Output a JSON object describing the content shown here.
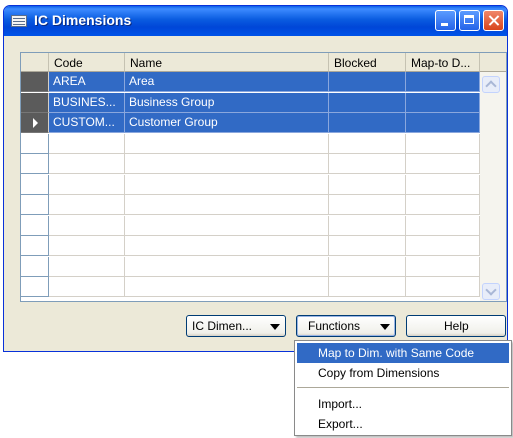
{
  "window": {
    "title": "IC Dimensions"
  },
  "grid": {
    "columns": [
      "Code",
      "Name",
      "Blocked",
      "Map-to D..."
    ],
    "rows": [
      {
        "code": "AREA",
        "name": "Area",
        "blocked": "",
        "map_to": ""
      },
      {
        "code": "BUSINES...",
        "name": "Business Group",
        "blocked": "",
        "map_to": ""
      },
      {
        "code": "CUSTOM...",
        "name": "Customer Group",
        "blocked": "",
        "map_to": ""
      }
    ],
    "empty_rows": 8
  },
  "buttons": {
    "ic_dimension": "IC Dimen...",
    "functions": "Functions",
    "help": "Help"
  },
  "menu": {
    "items": [
      "Map to Dim. with Same Code",
      "Copy from Dimensions",
      "Import...",
      "Export..."
    ],
    "highlighted_index": 0
  },
  "colors": {
    "selection": "#316ac5",
    "titlebar": "#0054e3",
    "window_bg": "#ece9d8"
  }
}
